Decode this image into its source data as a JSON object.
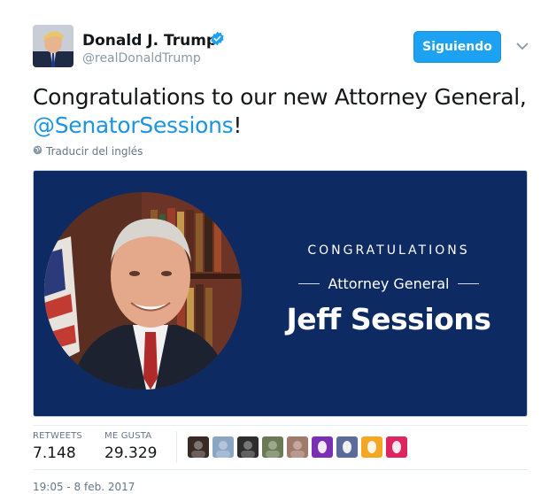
{
  "author": {
    "display_name": "Donald J. Trump",
    "handle": "@realDonaldTrump",
    "verified": true
  },
  "follow_button": {
    "label": "Siguiendo"
  },
  "tweet": {
    "text_before": "Congratulations to our new Attorney General, ",
    "mention": "@SenatorSessions",
    "text_after": "!",
    "translate_label": "Traducir del inglés"
  },
  "media": {
    "congrats_label": "CONGRATULATIONS",
    "role_label": "Attorney General",
    "name_label": "Jeff Sessions",
    "background_color": "#0d2a63"
  },
  "stats": {
    "retweets_label": "RETWEETS",
    "retweets_value": "7.148",
    "likes_label": "ME GUSTA",
    "likes_value": "29.329"
  },
  "likers": [
    {
      "name": "liker-avatar-1",
      "color": "#3a2a24"
    },
    {
      "name": "liker-avatar-2",
      "color": "#8aa6c4"
    },
    {
      "name": "liker-avatar-3",
      "color": "#2d2d2d"
    },
    {
      "name": "liker-avatar-4",
      "color": "#6b7a55"
    },
    {
      "name": "liker-avatar-5",
      "color": "#a07a6a"
    },
    {
      "name": "liker-avatar-6",
      "color": "#7b2fb5"
    },
    {
      "name": "liker-avatar-7",
      "color": "#5a6b9a"
    },
    {
      "name": "liker-avatar-8",
      "color": "#f5a623"
    },
    {
      "name": "liker-avatar-9",
      "color": "#e0245e"
    }
  ],
  "timestamp": "19:05 - 8 feb. 2017",
  "colors": {
    "link": "#1b95e0",
    "button": "#1da1f2",
    "muted": "#657786"
  }
}
